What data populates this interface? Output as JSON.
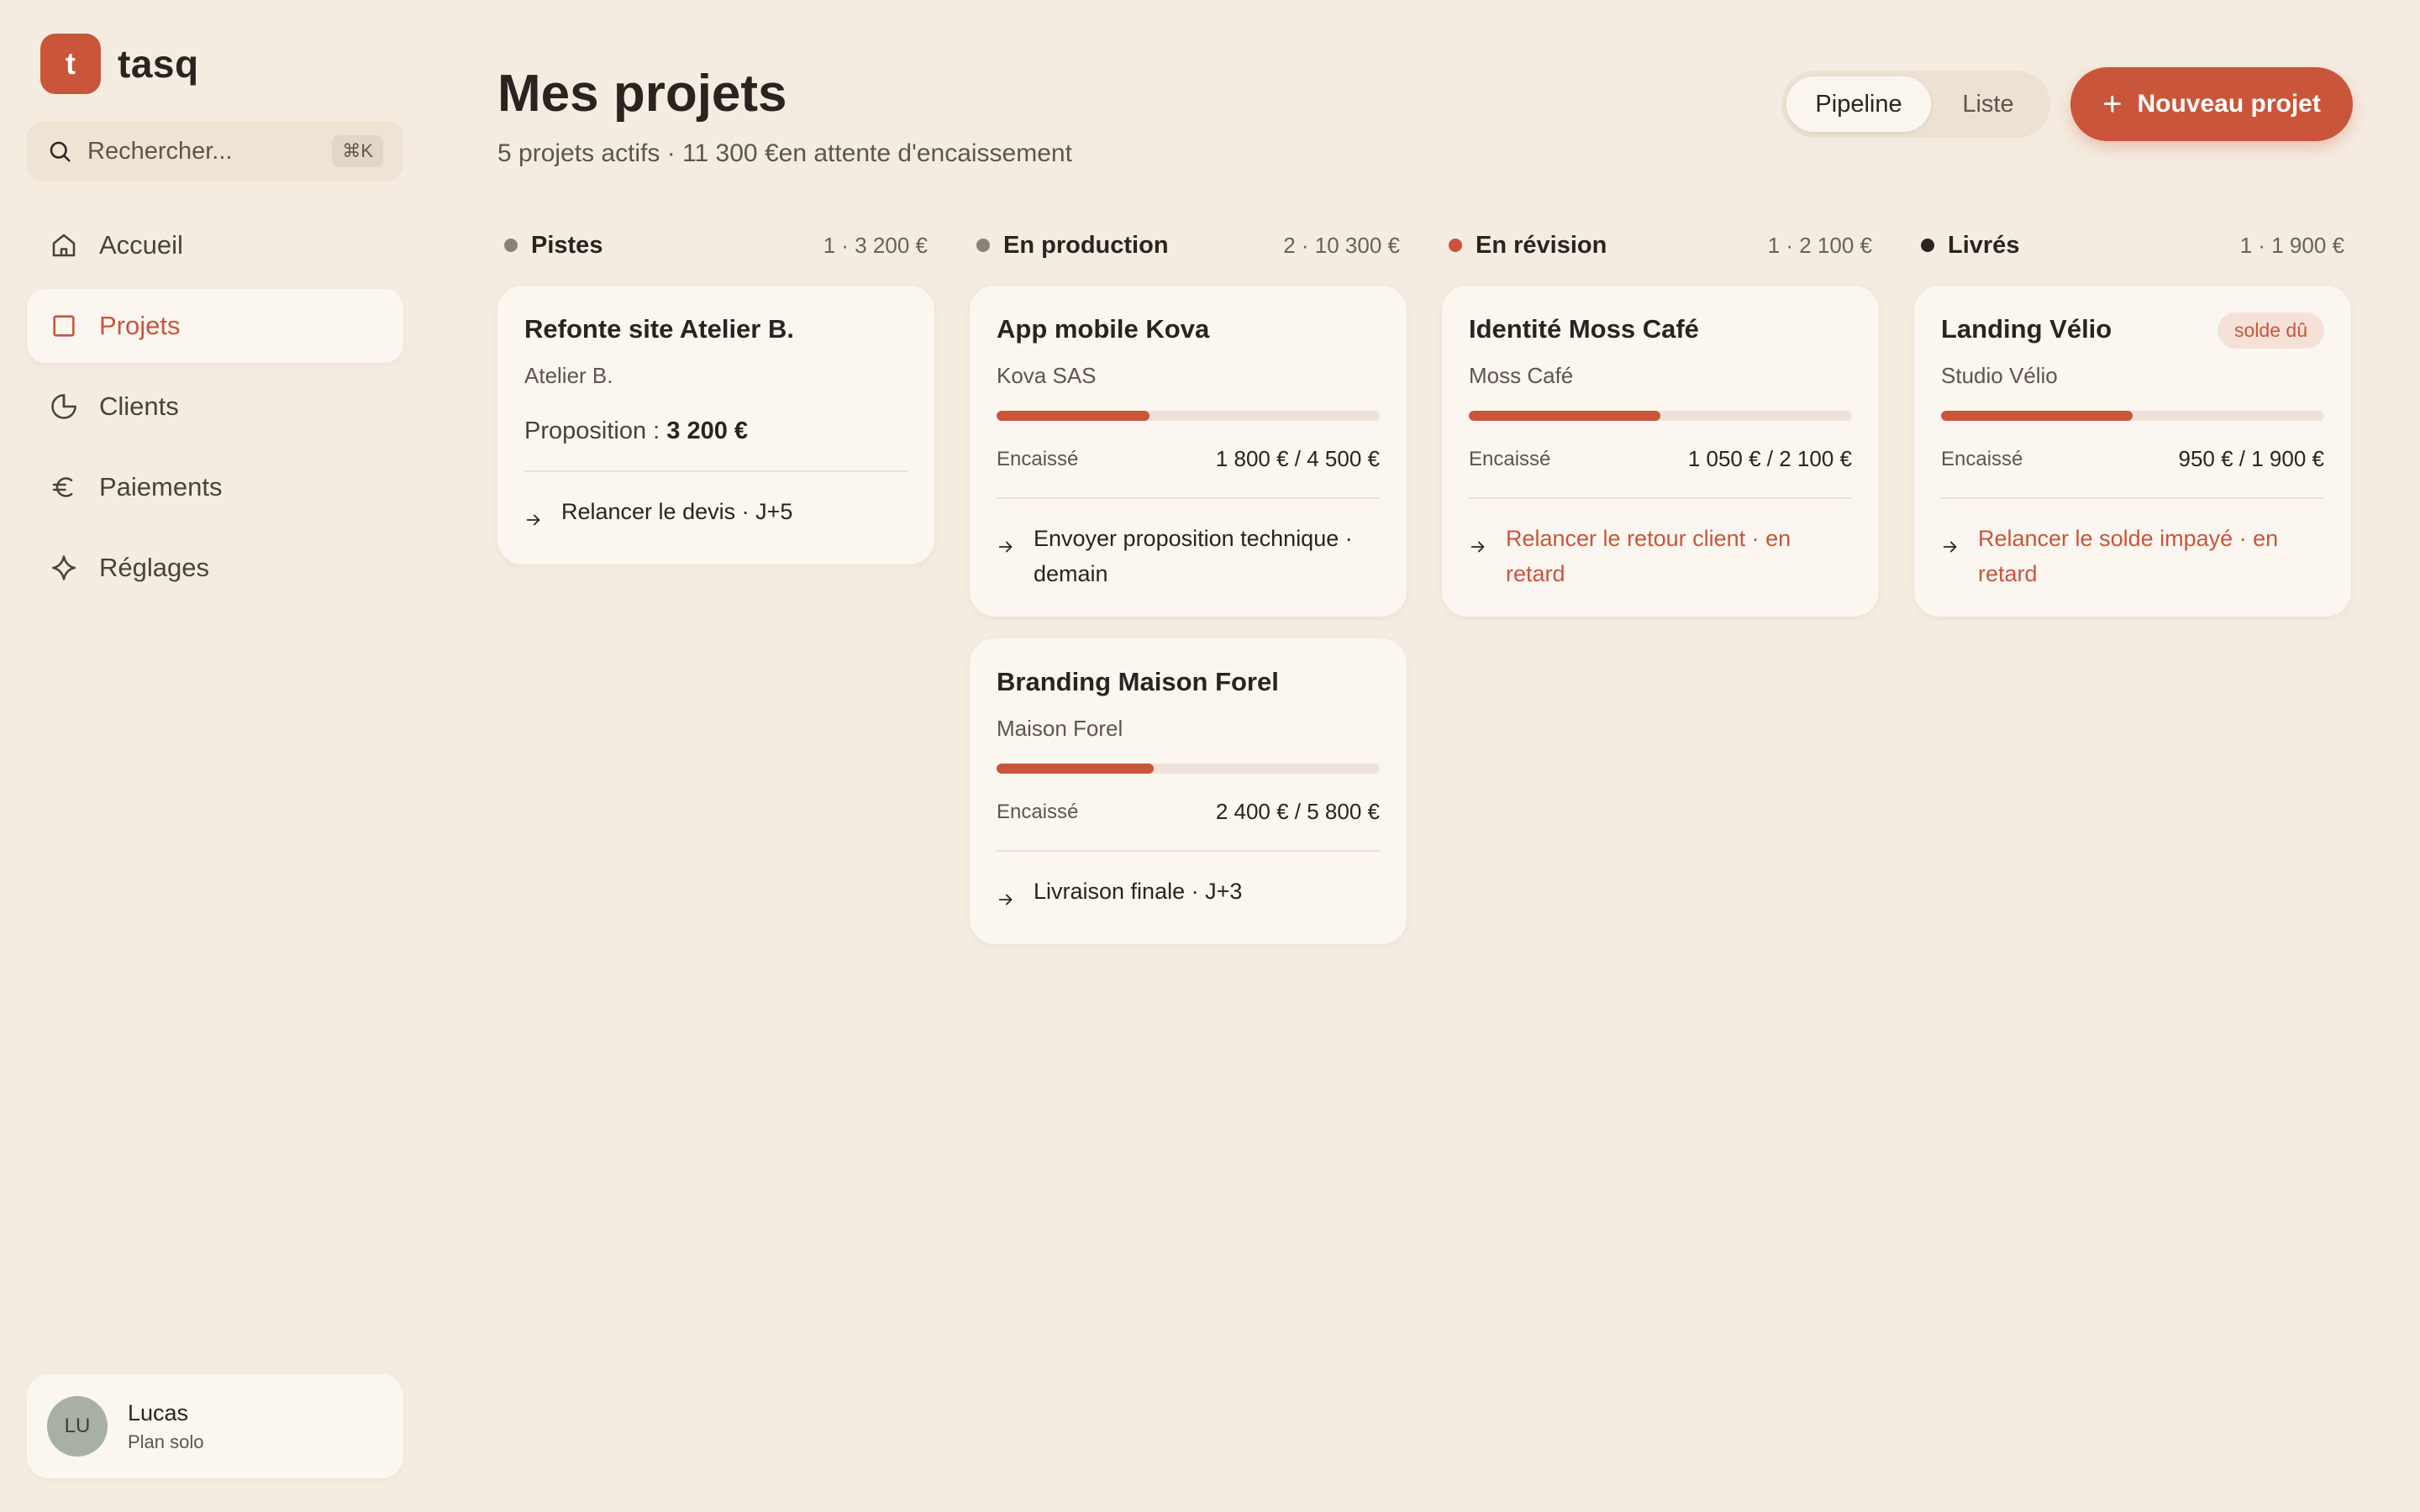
{
  "app": {
    "logo_letter": "t",
    "name": "tasq"
  },
  "search": {
    "placeholder": "Rechercher...",
    "shortcut": "⌘K"
  },
  "sidebar": {
    "items": [
      {
        "label": "Accueil",
        "icon": "home-icon",
        "active": false
      },
      {
        "label": "Projets",
        "icon": "square-icon",
        "active": true
      },
      {
        "label": "Clients",
        "icon": "pie-chart-icon",
        "active": false
      },
      {
        "label": "Paiements",
        "icon": "euro-icon",
        "active": false
      },
      {
        "label": "Réglages",
        "icon": "sparkle-icon",
        "active": false
      }
    ]
  },
  "user": {
    "initials": "LU",
    "name": "Lucas",
    "plan": "Plan solo"
  },
  "header": {
    "title": "Mes projets",
    "subtitle": "5 projets actifs · 11 300 €en attente d'encaissement",
    "view_toggle": {
      "active": "Pipeline",
      "inactive": "Liste"
    },
    "new_button": "Nouveau projet"
  },
  "colors": {
    "accent": "#c9553a",
    "background": "#f5ece1",
    "card": "#fbf6f0",
    "dot_gray": "#8c8177",
    "dot_dark": "#2a2420"
  },
  "columns": [
    {
      "name": "Pistes",
      "meta": "1 · 3 200 €",
      "dot": "#8c8177",
      "cards": [
        {
          "title": "Refonte site Atelier B.",
          "client": "Atelier B.",
          "proposal_label": "Proposition : ",
          "proposal_value": "3 200 €",
          "next": "Relancer le devis · J+5",
          "late": false
        }
      ]
    },
    {
      "name": "En production",
      "meta": "2 · 10 300 €",
      "dot": "#8c8177",
      "cards": [
        {
          "title": "App mobile Kova",
          "client": "Kova SAS",
          "progress": 0.4,
          "paid_label": "Encaissé",
          "paid_value": "1 800 € / 4 500 €",
          "next": "Envoyer proposition technique · demain",
          "late": false
        },
        {
          "title": "Branding Maison Forel",
          "client": "Maison Forel",
          "progress": 0.41,
          "paid_label": "Encaissé",
          "paid_value": "2 400 € / 5 800 €",
          "next": "Livraison finale · J+3",
          "late": false
        }
      ]
    },
    {
      "name": "En révision",
      "meta": "1 · 2 100 €",
      "dot": "#c9553a",
      "cards": [
        {
          "title": "Identité Moss Café",
          "client": "Moss Café",
          "progress": 0.5,
          "paid_label": "Encaissé",
          "paid_value": "1 050 € / 2 100 €",
          "next": "Relancer le retour client · en retard",
          "late": true
        }
      ]
    },
    {
      "name": "Livrés",
      "meta": "1 · 1 900 €",
      "dot": "#2a2420",
      "cards": [
        {
          "title": "Landing Vélio",
          "client": "Studio Vélio",
          "badge": "solde dû",
          "progress": 0.5,
          "paid_label": "Encaissé",
          "paid_value": "950 € / 1 900 €",
          "next": "Relancer le solde impayé · en retard",
          "late": true
        }
      ]
    }
  ]
}
